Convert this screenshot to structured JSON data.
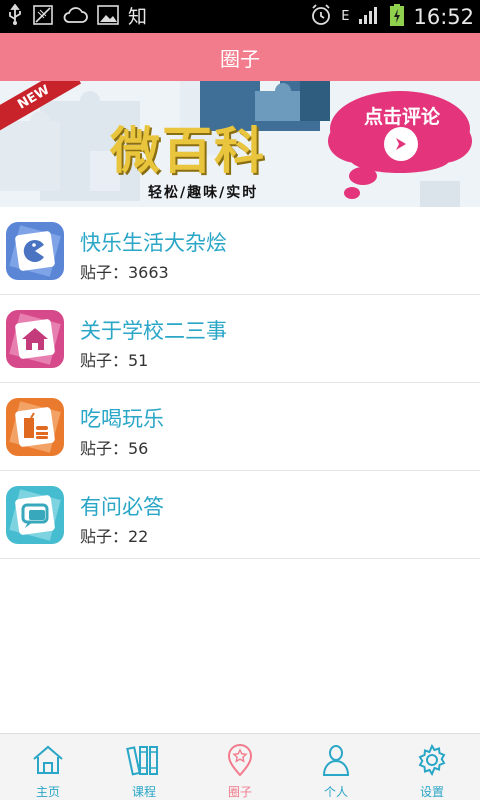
{
  "status_bar": {
    "notif_text": "知",
    "network": "E",
    "time": "16:52"
  },
  "header": {
    "title": "圈子"
  },
  "banner": {
    "badge": "NEW",
    "title": "微百科",
    "subtitle": "轻松/趣味/实时",
    "cta": "点击评论"
  },
  "circles": [
    {
      "title": "快乐生活大杂烩",
      "count": "贴子：3663",
      "icon": "pacman-icon",
      "color": "#5b86d6"
    },
    {
      "title": "关于学校二三事",
      "count": "贴子：51",
      "icon": "house-icon",
      "color": "#d6498a"
    },
    {
      "title": "吃喝玩乐",
      "count": "贴子：56",
      "icon": "food-icon",
      "color": "#ea7a2e"
    },
    {
      "title": "有问必答",
      "count": "贴子：22",
      "icon": "chat-icon",
      "color": "#45bccf"
    }
  ],
  "nav": {
    "home": "主页",
    "courses": "课程",
    "circle": "圈子",
    "profile": "个人",
    "settings": "设置"
  },
  "colors": {
    "accent": "#f27b8c",
    "link": "#2aa6c7"
  }
}
